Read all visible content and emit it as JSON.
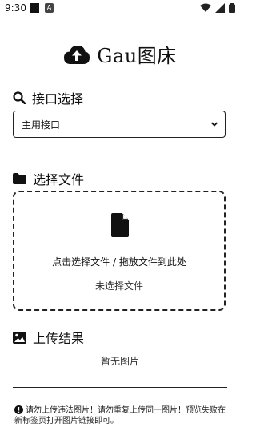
{
  "status_bar": {
    "time": "9:30",
    "notif_label": "A"
  },
  "header": {
    "title": "Gau图床"
  },
  "interface": {
    "heading": "接口选择",
    "selected": "主用接口"
  },
  "files": {
    "heading": "选择文件",
    "drop_hint": "点击选择文件 / 拖放文件到此处",
    "status": "未选择文件"
  },
  "results": {
    "heading": "上传结果",
    "empty": "暂无图片"
  },
  "footer": {
    "notice": "请勿上传违法图片！请勿重复上传同一图片！预览失败在新标签页打开图片链接即可。"
  },
  "colors": {
    "foreground": "#111111",
    "background": "#ffffff"
  }
}
